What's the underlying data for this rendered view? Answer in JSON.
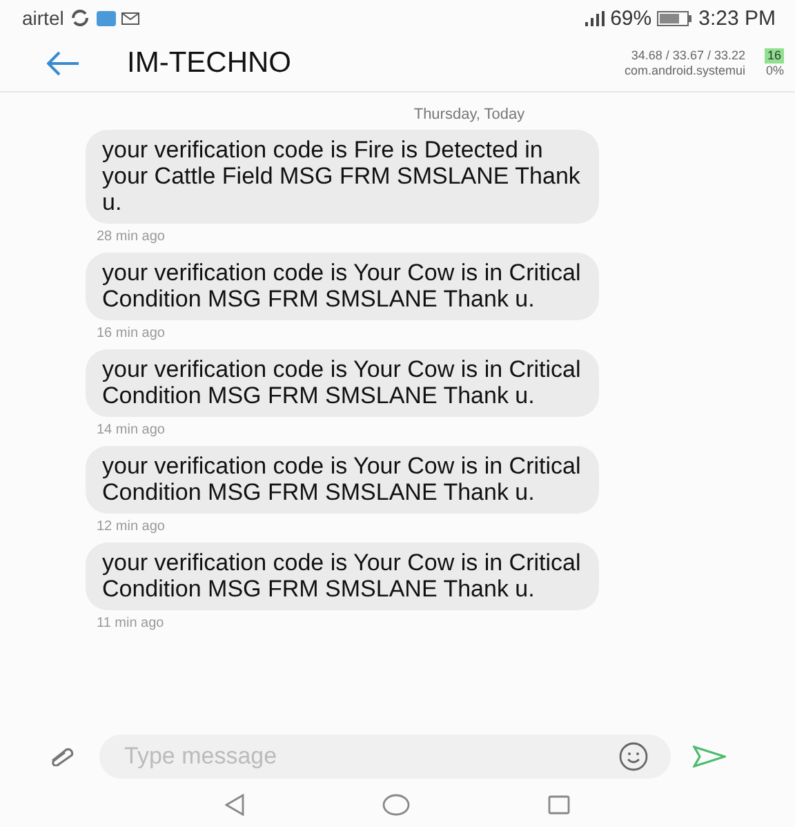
{
  "status_bar": {
    "carrier": "airtel",
    "battery": "69%",
    "time": "3:23 PM",
    "overlay_line_1": "34.68 / 33.67 / 33.22",
    "overlay_line_2": "com.android.systemui",
    "overlay_badge": "16",
    "overlay_percent": "0%"
  },
  "header": {
    "title": "IM-TECHNO"
  },
  "date_label": "Thursday, Today",
  "messages": [
    {
      "text": "your verification code is Fire is Detected in your Cattle Field MSG FRM SMSLANE Thank u.",
      "time": "28 min ago"
    },
    {
      "text": "your verification code is Your Cow is in Critical Condition MSG FRM SMSLANE Thank u.",
      "time": "16 min ago"
    },
    {
      "text": "your verification code is Your Cow is in Critical Condition MSG FRM SMSLANE Thank u.",
      "time": "14 min ago"
    },
    {
      "text": "your verification code is Your Cow is in Critical Condition MSG FRM SMSLANE Thank u.",
      "time": "12 min ago"
    },
    {
      "text": "your verification code is Your Cow is in Critical Condition MSG FRM SMSLANE Thank u.",
      "time": "11 min ago"
    }
  ],
  "composer": {
    "placeholder": "Type message"
  }
}
